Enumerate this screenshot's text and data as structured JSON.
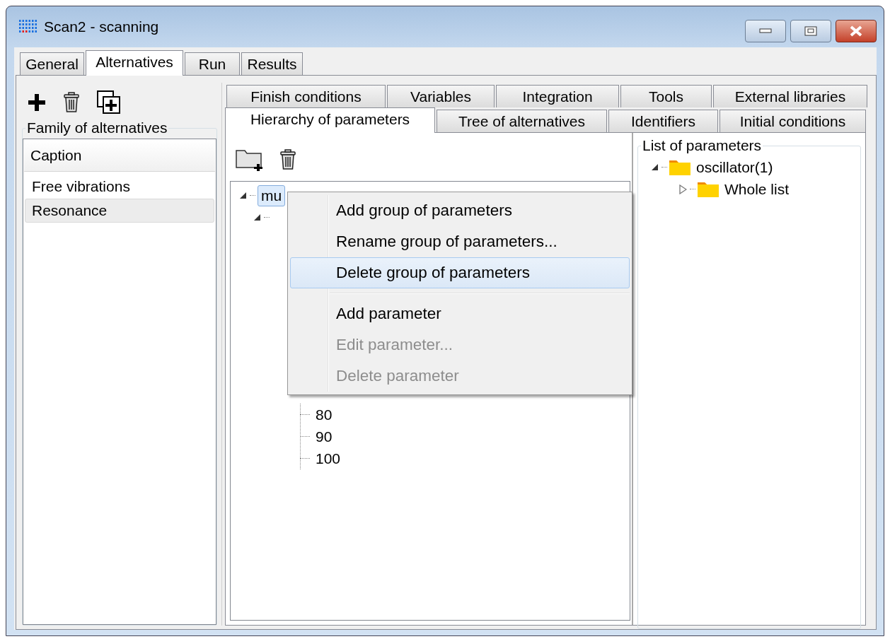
{
  "window": {
    "title": "Scan2 - scanning"
  },
  "main_tabs": [
    {
      "label": "General",
      "selected": false
    },
    {
      "label": "Alternatives",
      "selected": true
    },
    {
      "label": "Run",
      "selected": false
    },
    {
      "label": "Results",
      "selected": false
    }
  ],
  "alternatives": {
    "group_title": "Family of alternatives",
    "list_header": "Caption",
    "items": [
      {
        "label": "Free vibrations",
        "selected": false
      },
      {
        "label": "Resonance",
        "selected": true
      }
    ]
  },
  "inner_tab_rows": [
    [
      {
        "label": "Finish conditions",
        "selected": false
      },
      {
        "label": "Variables",
        "selected": false
      },
      {
        "label": "Integration",
        "selected": false
      },
      {
        "label": "Tools",
        "selected": false
      },
      {
        "label": "External libraries",
        "selected": false
      }
    ],
    [
      {
        "label": "Hierarchy of parameters",
        "selected": true
      },
      {
        "label": "Tree of alternatives",
        "selected": false
      },
      {
        "label": "Identifiers",
        "selected": false
      },
      {
        "label": "Initial conditions",
        "selected": false
      }
    ]
  ],
  "hierarchy_tree": [
    {
      "label": "mu",
      "selected": true,
      "expanded": true,
      "children": [
        {
          "expanded": true,
          "children": [
            {
              "label": "80",
              "selected": false
            },
            {
              "label": "90",
              "selected": false
            },
            {
              "label": "100",
              "selected": false
            }
          ]
        }
      ]
    }
  ],
  "parameter_list": {
    "group_title": "List of parameters",
    "tree": [
      {
        "label": "oscillator(1)",
        "expanded": true,
        "children": [
          {
            "label": "Whole list",
            "expanded": false
          }
        ]
      }
    ]
  },
  "context_menu": [
    {
      "kind": "item",
      "label": "Add group of parameters",
      "disabled": false,
      "selected": false
    },
    {
      "kind": "item",
      "label": "Rename group of parameters...",
      "disabled": false,
      "selected": false
    },
    {
      "kind": "item",
      "label": "Delete group of parameters",
      "disabled": false,
      "selected": true
    },
    {
      "kind": "separator"
    },
    {
      "kind": "item",
      "label": "Add parameter",
      "disabled": false,
      "selected": false
    },
    {
      "kind": "item",
      "label": "Edit parameter...",
      "disabled": true,
      "selected": false
    },
    {
      "kind": "item",
      "label": "Delete parameter",
      "disabled": true,
      "selected": false
    }
  ]
}
